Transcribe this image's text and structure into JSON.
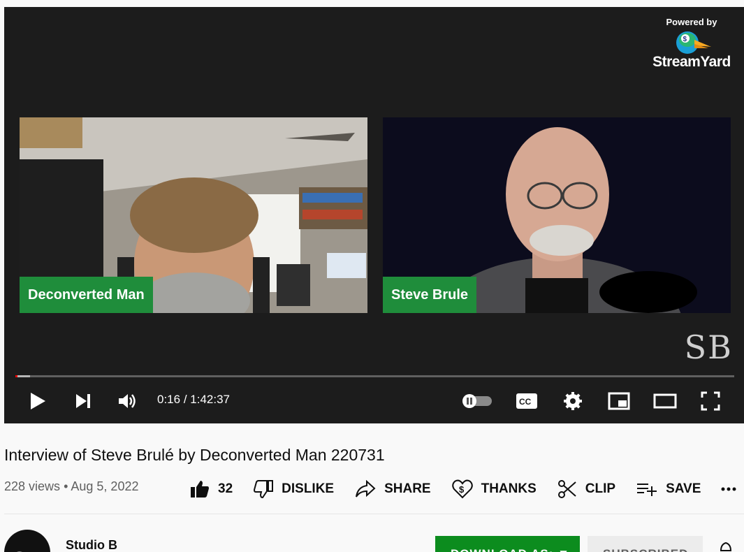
{
  "overlay": {
    "powered_by": "Powered by",
    "brand_name": "StreamYard",
    "watermark": "SB"
  },
  "participants": [
    {
      "name": "Deconverted Man"
    },
    {
      "name": "Steve Brule"
    }
  ],
  "player": {
    "current_time": "0:16",
    "separator": "/",
    "duration": "1:42:37",
    "progress_fraction": 0.0026,
    "autoplay": false
  },
  "video": {
    "title": "Interview of Steve Brulé by Deconverted Man 220731",
    "views": "228 views",
    "dot": "•",
    "date": "Aug 5, 2022"
  },
  "actions": {
    "likes": "32",
    "dislike": "DISLIKE",
    "share": "SHARE",
    "thanks": "THANKS",
    "clip": "CLIP",
    "save": "SAVE",
    "more": "..."
  },
  "channel": {
    "avatar_text": "SB",
    "name": "Studio B",
    "download_label": "DOWNLOAD AS: ▼",
    "subscribed_label": "SUBSCRIBED"
  },
  "colors": {
    "accent_green": "#1f8d3b",
    "progress_red": "#ff0000",
    "download_green": "#0c8c1e"
  },
  "icons": [
    "play-icon",
    "next-icon",
    "volume-icon",
    "autoplay-toggle-icon",
    "captions-icon",
    "settings-gear-icon",
    "miniplayer-icon",
    "theater-icon",
    "fullscreen-icon",
    "thumbs-up-icon",
    "thumbs-down-icon",
    "share-arrow-icon",
    "thanks-heart-icon",
    "clip-scissors-icon",
    "save-playlist-icon",
    "more-icon",
    "bell-icon"
  ]
}
